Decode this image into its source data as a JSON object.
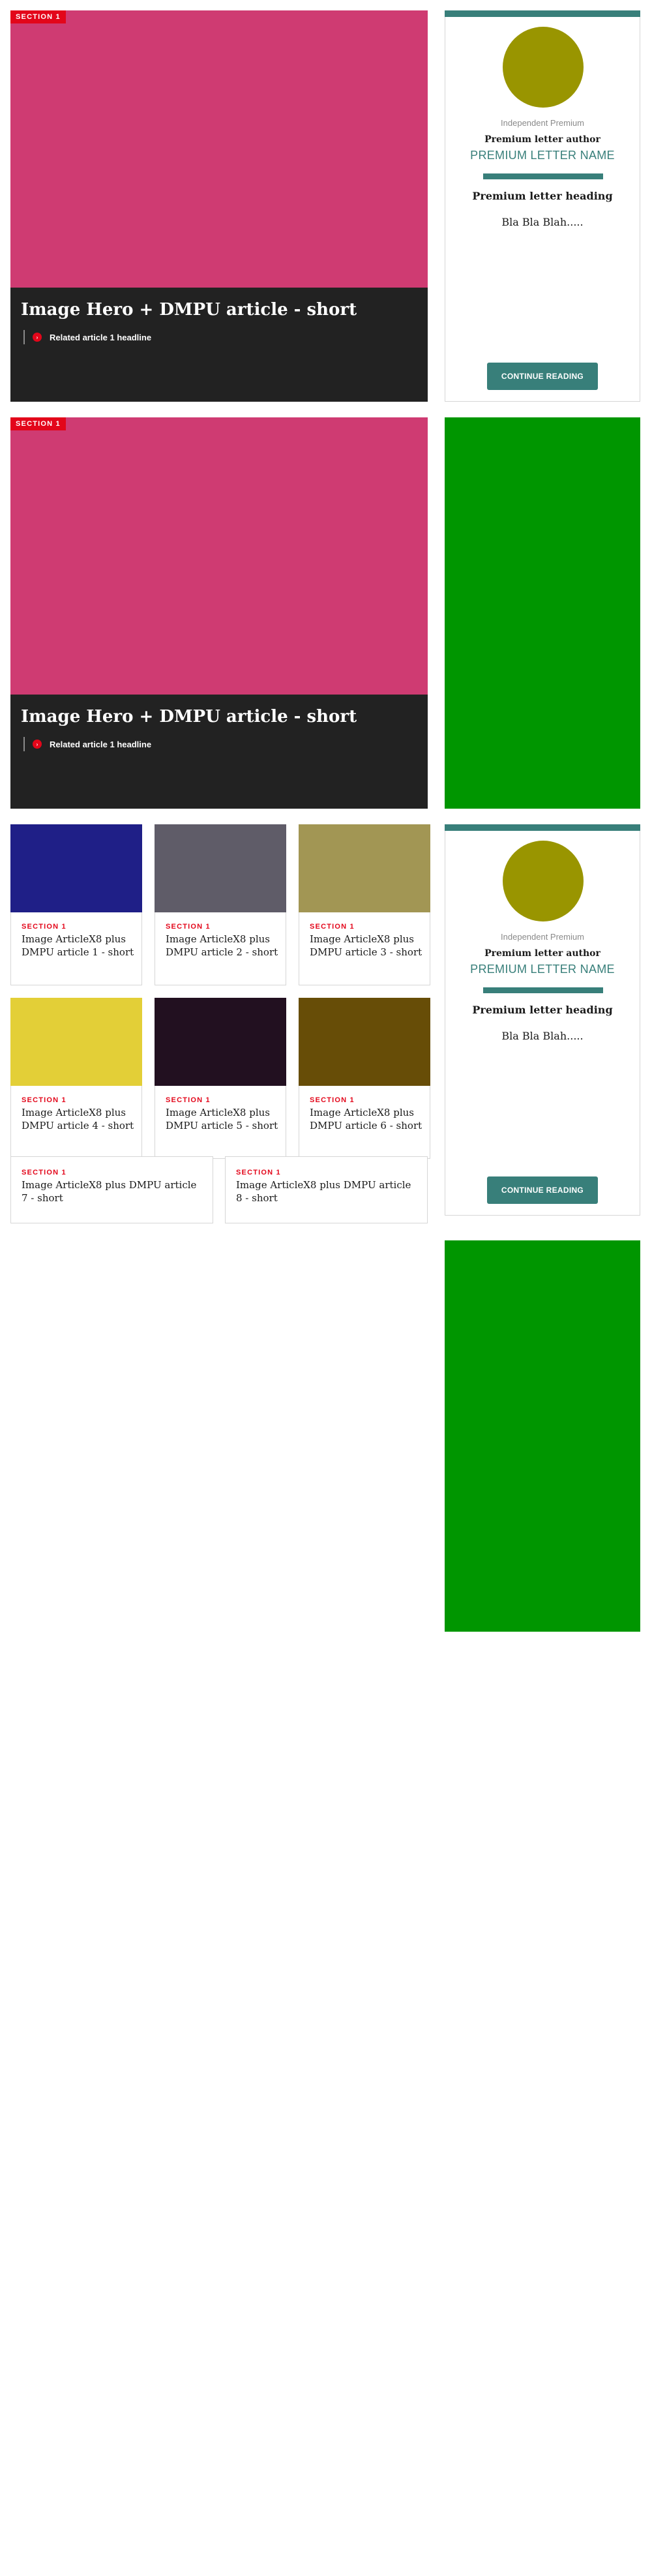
{
  "heroes": [
    {
      "section": "Section 1",
      "image_color": "#cf3b72",
      "title": "Image Hero + DMPU article - short",
      "related": "Related article 1 headline"
    },
    {
      "section": "Section 1",
      "image_color": "#cf3b72",
      "title": "Image Hero + DMPU article - short",
      "related": "Related article 1 headline"
    }
  ],
  "premium": [
    {
      "brand": "Independent Premium",
      "author": "Premium letter author",
      "letter_name": "PREMIUM LETTER NAME",
      "heading": "Premium letter heading",
      "body": "Bla Bla Blah.....",
      "cta": "CONTINUE READING",
      "avatar_color": "#999500",
      "accent_color": "#387f7a"
    },
    {
      "brand": "Independent Premium",
      "author": "Premium letter author",
      "letter_name": "PREMIUM LETTER NAME",
      "heading": "Premium letter heading",
      "body": "Bla Bla Blah.....",
      "cta": "CONTINUE READING",
      "avatar_color": "#999500",
      "accent_color": "#387f7a"
    }
  ],
  "ads": [
    {
      "color": "#009600"
    },
    {
      "color": "#009600"
    }
  ],
  "cards": [
    {
      "section": "Section 1",
      "title": "Image ArticleX8 plus DMPU article 1 - short",
      "image_color": "#1f1f87"
    },
    {
      "section": "Section 1",
      "title": "Image ArticleX8 plus DMPU article 2 - short",
      "image_color": "#5f5c68"
    },
    {
      "section": "Section 1",
      "title": "Image ArticleX8 plus DMPU article 3 - short",
      "image_color": "#a29654"
    },
    {
      "section": "Section 1",
      "title": "Image ArticleX8 plus DMPU article 4 - short",
      "image_color": "#e3cf37"
    },
    {
      "section": "Section 1",
      "title": "Image ArticleX8 plus DMPU article 5 - short",
      "image_color": "#221020"
    },
    {
      "section": "Section 1",
      "title": "Image ArticleX8 plus DMPU article 6 - short",
      "image_color": "#674d07"
    }
  ],
  "text_cards": [
    {
      "section": "Section 1",
      "title": "Image ArticleX8 plus DMPU article 7 - short"
    },
    {
      "section": "Section 1",
      "title": "Image ArticleX8 plus DMPU article 8 - short"
    }
  ],
  "colors": {
    "section_red": "#e3061a",
    "hero_dark": "#222222",
    "premium_teal": "#387f7a"
  }
}
